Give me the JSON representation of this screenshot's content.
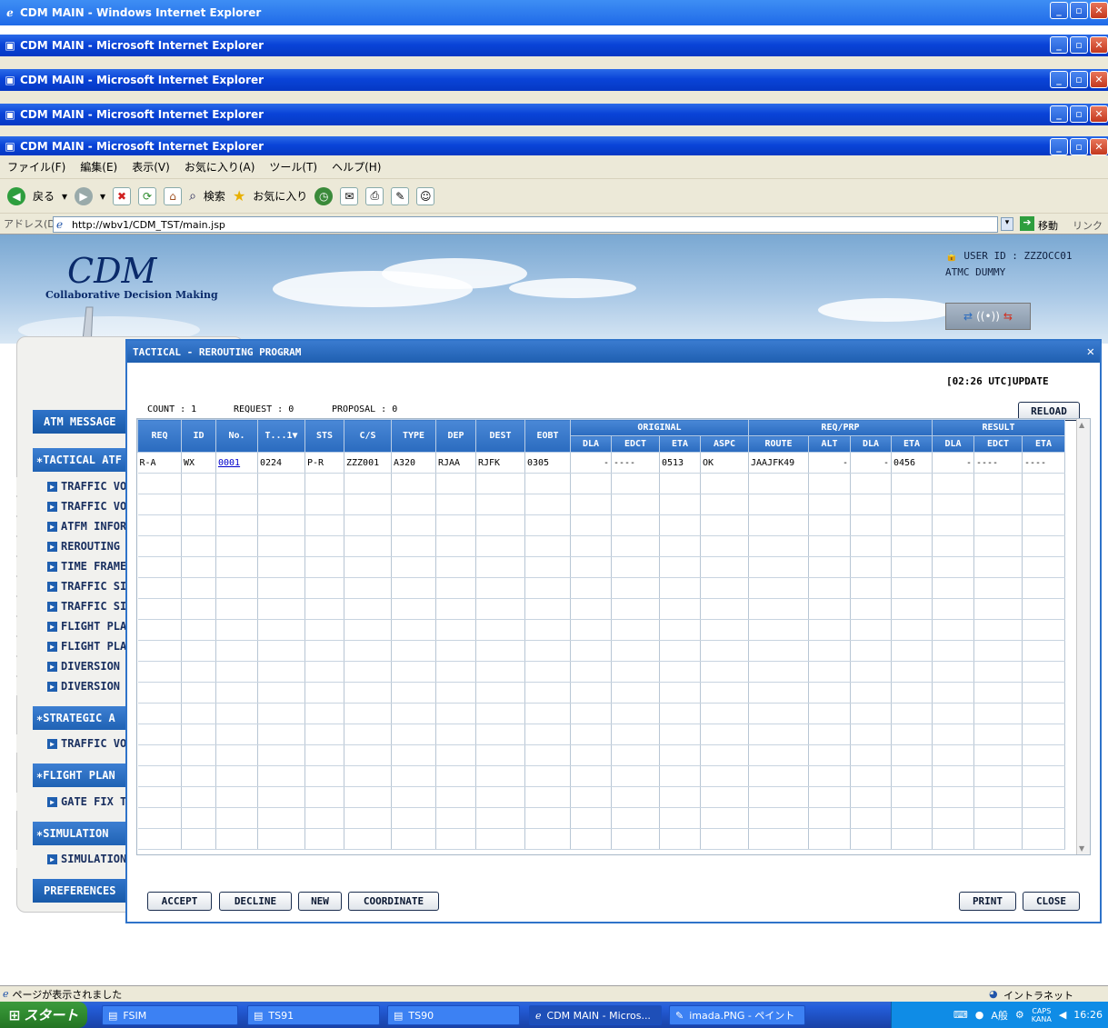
{
  "windows": {
    "top_title": "CDM MAIN - Windows Internet Explorer",
    "stacked_titles": [
      "CDM MAIN - Microsoft Internet Explorer",
      "CDM MAIN - Microsoft Internet Explorer",
      "CDM MAIN - Microsoft Internet Explorer",
      "CDM MAIN - Microsoft Internet Explorer"
    ]
  },
  "menubar": [
    "ファイル(F)",
    "編集(E)",
    "表示(V)",
    "お気に入り(A)",
    "ツール(T)",
    "ヘルプ(H)"
  ],
  "toolbar": {
    "back": "戻る",
    "search": "検索",
    "favorites": "お気に入り"
  },
  "address": {
    "label": "アドレス(D)",
    "url": "http://wbv1/CDM_TST/main.jsp",
    "go": "移動",
    "links": "リンク"
  },
  "header": {
    "logo": "CDM",
    "logo_sub": "Collaborative Decision Making",
    "user_id_label": "USER ID : ZZZOCC01",
    "user_name": "ATMC DUMMY"
  },
  "sidebar": {
    "atm_message": "ATM MESSAGE",
    "tactical": "∗TACTICAL ATF",
    "tactical_items": [
      "TRAFFIC VO",
      "TRAFFIC VO",
      "ATFM INFOR",
      "REROUTING",
      "TIME FRAME",
      "TRAFFIC SI",
      "TRAFFIC SI",
      "FLIGHT PLA",
      "FLIGHT PLA",
      "DIVERSION",
      "DIVERSION"
    ],
    "strategic": "∗STRATEGIC A",
    "strategic_items": [
      "TRAFFIC VO"
    ],
    "flight_plan": "∗FLIGHT PLAN",
    "flight_plan_items": [
      "GATE FIX T"
    ],
    "simulation": "∗SIMULATION",
    "simulation_items": [
      "SIMULATION"
    ],
    "preferences": "PREFERENCES"
  },
  "dialog": {
    "title": "TACTICAL - REROUTING PROGRAM",
    "update": "[02:26 UTC]UPDATE",
    "count": "COUNT : 1",
    "request": "REQUEST : 0",
    "proposal": "PROPOSAL : 0",
    "reload": "RELOAD",
    "buttons": {
      "accept": "ACCEPT",
      "decline": "DECLINE",
      "new": "NEW",
      "coordinate": "COORDINATE",
      "print": "PRINT",
      "close": "CLOSE"
    },
    "group_headers": [
      "ORIGINAL",
      "REQ/PRP",
      "RESULT"
    ],
    "columns": [
      "REQ",
      "ID",
      "No.",
      "T...1▼",
      "STS",
      "C/S",
      "TYPE",
      "DEP",
      "DEST",
      "EOBT",
      "DLA",
      "EDCT",
      "ETA",
      "ASPC",
      "ROUTE",
      "ALT",
      "DLA",
      "ETA",
      "DLA",
      "EDCT",
      "ETA"
    ],
    "rows": [
      [
        "R-A",
        "WX",
        "0001",
        "0224",
        "P-R",
        "ZZZ001",
        "A320",
        "RJAA",
        "RJFK",
        "0305",
        "-",
        "----",
        "0513",
        "OK",
        "JAAJFK49",
        "-",
        "-",
        "0456",
        "-",
        "----",
        "----"
      ]
    ]
  },
  "status": {
    "text": "ページが表示されました",
    "zone": "イントラネット"
  },
  "taskbar": {
    "start": "スタート",
    "tasks": [
      "FSIM",
      "TS91",
      "TS90",
      "CDM MAIN - Micros...",
      "imada.PNG - ペイント"
    ],
    "ime": "A般",
    "caps": "CAPS",
    "kana": "KANA",
    "clock": "16:26"
  },
  "colors": {
    "titlebar": "#0a44d8",
    "dialog_header": "#2a6bbf",
    "accent": "#2f73c9"
  }
}
